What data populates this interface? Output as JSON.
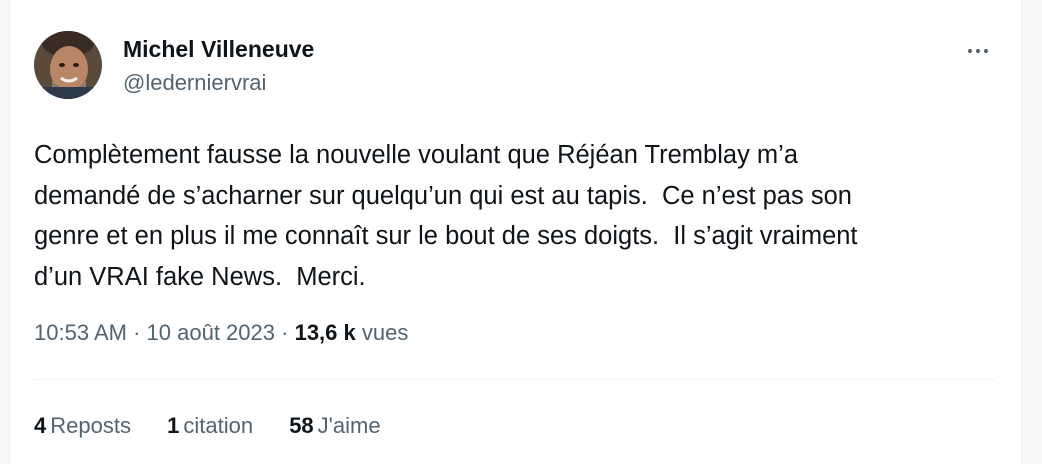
{
  "author": {
    "name": "Michel Villeneuve",
    "handle": "@ledernierv​rai"
  },
  "tweet": {
    "text": "Complètement fausse la nouvelle voulant que Réjéan Tremblay m’a\ndemandé de s’acharner sur quelqu’un qui est au tapis.  Ce n’est pas son\ngenre et en plus il me connaît sur le bout de ses doigts.  Il s’agit vraiment\nd’un VRAI fake News.  Merci."
  },
  "meta": {
    "time": "10:53 AM",
    "sep1": "·",
    "date": "10 août 2023",
    "sep2": "·",
    "views_count": "13,6 k",
    "views_label": "vues"
  },
  "stats": {
    "reposts_count": "4",
    "reposts_label": "Reposts",
    "quotes_count": "1",
    "quotes_label": "citation",
    "likes_count": "58",
    "likes_label": "J'aime"
  },
  "icons": {
    "more": "more-horizontal-icon"
  },
  "colors": {
    "text_primary": "#0f1419",
    "text_secondary": "#536471",
    "divider": "#eff3f4"
  }
}
